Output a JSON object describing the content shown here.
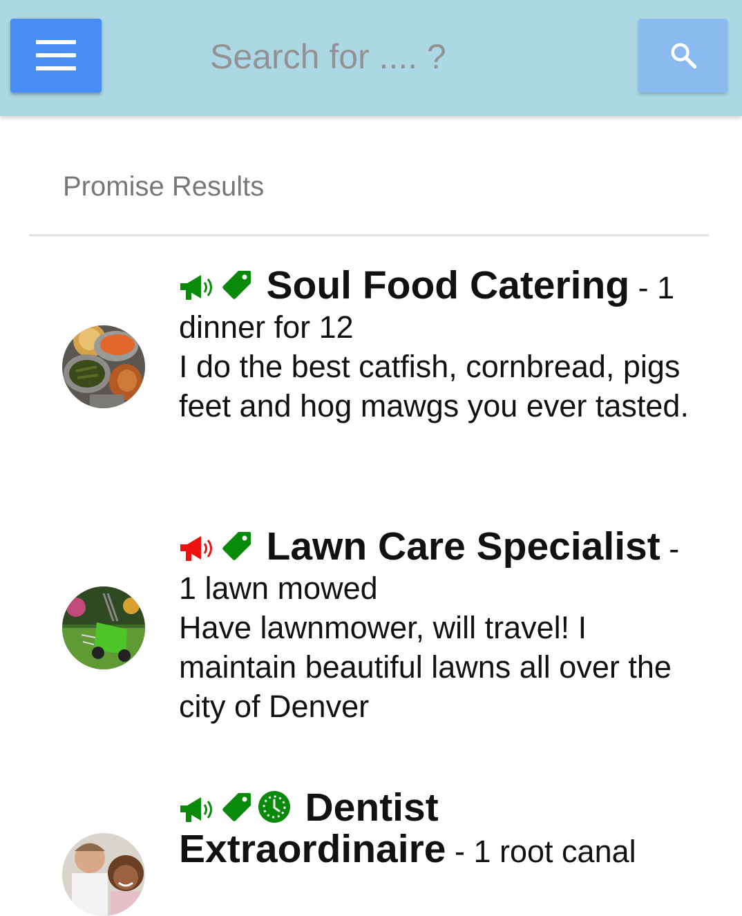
{
  "header": {
    "menu_icon": "hamburger-menu-icon",
    "search_placeholder": "Search for .... ?",
    "search_icon": "magnifier-icon",
    "colors": {
      "bar": "#acd8e6",
      "menu_button": "#4a8ef5",
      "search_button": "#8bbaf0"
    }
  },
  "section": {
    "title": "Promise Results"
  },
  "results": [
    {
      "title": "Soul Food Catering",
      "sep": " - ",
      "subtitle": "1 dinner for 12",
      "description": "I do the best catfish, cornbread, pigs feet and hog mawgs you ever tasted.",
      "icons": [
        "megaphone-icon",
        "tag-icon"
      ],
      "megaphone_color": "#0a8a0a",
      "avatar": "soul-food-plate-image"
    },
    {
      "title": "Lawn Care Specialist",
      "sep": " - ",
      "subtitle": "1 lawn mowed",
      "description": "Have lawnmower, will travel! I maintain beautiful lawns all over the city of Denver",
      "icons": [
        "megaphone-icon",
        "tag-icon"
      ],
      "megaphone_color": "#ee1111",
      "avatar": "lawnmower-image"
    },
    {
      "title": "Dentist Extraordinaire",
      "sep": " - ",
      "subtitle": "1 root canal",
      "description": "",
      "icons": [
        "megaphone-icon",
        "tag-icon",
        "clock-icon"
      ],
      "megaphone_color": "#0a8a0a",
      "avatar": "dentist-with-child-image"
    }
  ]
}
